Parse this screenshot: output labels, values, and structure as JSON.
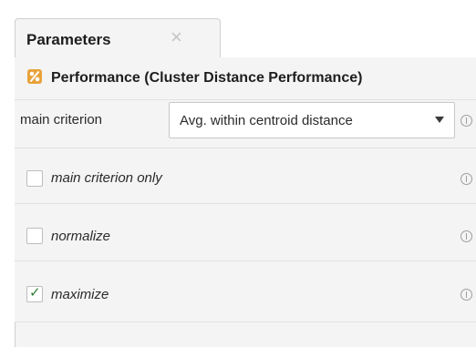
{
  "tab": {
    "label": "Parameters",
    "close_icon": "close-icon"
  },
  "operator": {
    "icon": "performance-icon",
    "title": "Performance (Cluster Distance Performance)"
  },
  "parameters": {
    "main_criterion": {
      "label": "main criterion",
      "value": "Avg. within centroid distance"
    },
    "main_criterion_only": {
      "label": "main criterion only",
      "checked": false
    },
    "normalize": {
      "label": "normalize",
      "checked": false
    },
    "maximize": {
      "label": "maximize",
      "checked": true,
      "check_glyph": "✓"
    }
  },
  "colors": {
    "panel_bg": "#f4f4f4",
    "check_green": "#2e7d32",
    "icon_orange": "#e8a23a"
  }
}
